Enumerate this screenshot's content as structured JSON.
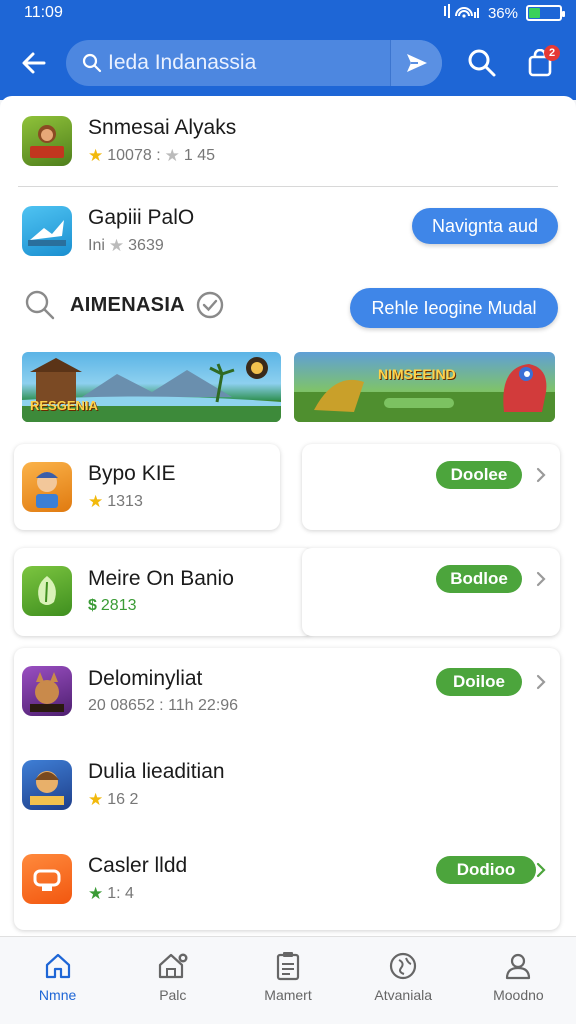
{
  "status_bar": {
    "time": "11:09",
    "signal": "▮⁝",
    "battery": "36%",
    "battery_level": 0.36
  },
  "header": {
    "search_placeholder": "Ieda Indanassia",
    "badge": "2",
    "icons": [
      "back-arrow-icon",
      "search-icon",
      "send-icon",
      "search-icon",
      "shopping-bag-icon"
    ]
  },
  "top_apps": [
    {
      "name": "Snmesai Alyaks",
      "meta": "10078 : ★ 1 45",
      "rating": "10078 :",
      "count": "1 45",
      "icon_text": "RIDA",
      "icon_color": "#6a9a2a"
    },
    {
      "name": "Gapiii PalO",
      "meta_prefix": "Ini",
      "rating": "3639",
      "icon_text": "",
      "icon_color": "#2fa6df"
    }
  ],
  "navigate_button": "Navignta aud",
  "section": {
    "title": "AIMENASIA",
    "button": "Rehle Ieogine Mudal"
  },
  "banners": [
    {
      "label": "RESGENIA",
      "accent": "#ffd24a"
    },
    {
      "label": "NIMSEEIND",
      "accent": "#ffd24a"
    }
  ],
  "cards": [
    {
      "name": "Bypo KIE",
      "rating": "1313",
      "button": "Doolee",
      "icon_color": "#f39c12"
    },
    {
      "name": "Meire On Banio",
      "rating": "2813",
      "currency": "$",
      "button": "Bodloe",
      "icon_color": "#5aa832"
    },
    {
      "name": "Delominyliat",
      "meta": "20 08652 : 11h 22:96",
      "button": "Doiloe",
      "icon_color": "#7b3fa0"
    },
    {
      "name": "Dulia lieaditian",
      "rating": "16 2",
      "icon_color": "#2d5aa0"
    },
    {
      "name": "Casler lldd",
      "rating": "1: 4",
      "button": "Dodioo",
      "icon_color": "#f26a1b"
    }
  ],
  "bottom_nav": [
    {
      "label": "Nmne",
      "icon": "home-icon",
      "active": true
    },
    {
      "label": "Palc",
      "icon": "store-icon",
      "active": false
    },
    {
      "label": "Mamert",
      "icon": "clipboard-icon",
      "active": false
    },
    {
      "label": "Atvaniala",
      "icon": "globe-icon",
      "active": false
    },
    {
      "label": "Moodno",
      "icon": "person-icon",
      "active": false
    }
  ],
  "colors": {
    "primary": "#1e66d6",
    "accent_blue": "#3f86e8",
    "accent_green": "#4ca53c"
  }
}
